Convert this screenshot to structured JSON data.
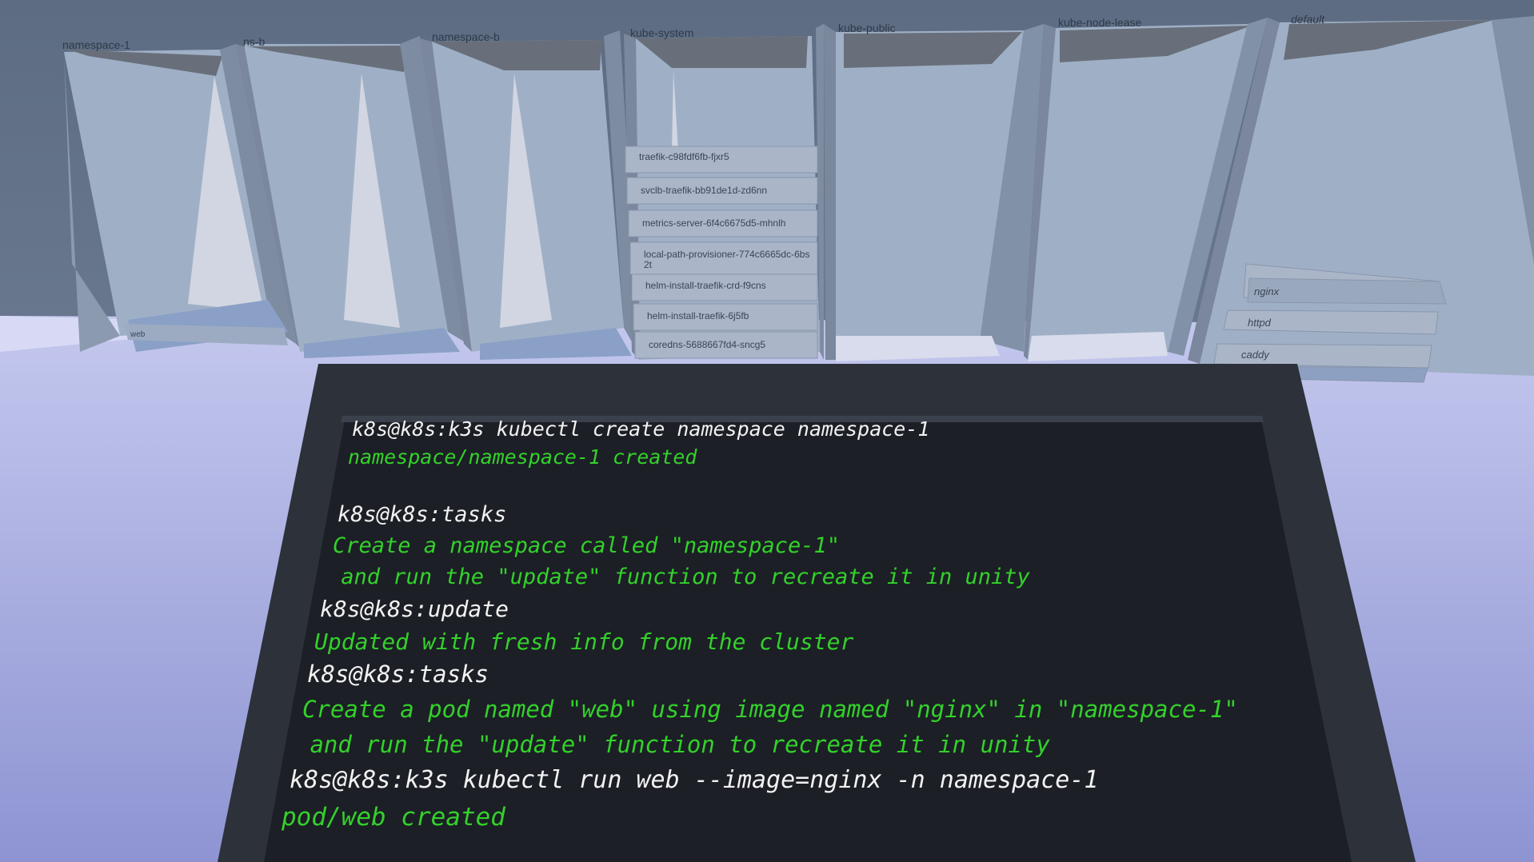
{
  "scene": {
    "namespaces": [
      {
        "name": "namespace-1",
        "pods": [
          "web"
        ]
      },
      {
        "name": "ns-b",
        "pods": []
      },
      {
        "name": "namespace-b",
        "pods": []
      },
      {
        "name": "kube-system",
        "pods": [
          "traefik-c98fdf6fb-fjxr5",
          "svclb-traefik-bb91de1d-zd6nn",
          "metrics-server-6f4c6675d5-mhnlh",
          "local-path-provisioner-774c6665dc-6bs2t",
          "helm-install-traefik-crd-f9cns",
          "helm-install-traefik-6j5fb",
          "coredns-5688667fd4-sncg5"
        ]
      },
      {
        "name": "kube-public",
        "pods": []
      },
      {
        "name": "kube-node-lease",
        "pods": []
      },
      {
        "name": "default",
        "pods": [
          "nginx",
          "httpd",
          "caddy"
        ]
      }
    ]
  },
  "terminal": {
    "lines": [
      {
        "type": "command",
        "text": "k8s@k8s:k3s kubectl create namespace namespace-1"
      },
      {
        "type": "output",
        "text": "namespace/namespace-1 created"
      },
      {
        "type": "command",
        "text": "k8s@k8s:tasks"
      },
      {
        "type": "output",
        "text": "Create a namespace called \"namespace-1\""
      },
      {
        "type": "output",
        "text": " and run the \"update\" function to recreate it in unity"
      },
      {
        "type": "command",
        "text": "k8s@k8s:update"
      },
      {
        "type": "output",
        "text": "Updated with fresh info from the cluster"
      },
      {
        "type": "command",
        "text": "k8s@k8s:tasks"
      },
      {
        "type": "output",
        "text": "Create a pod named \"web\" using image named \"nginx\" in \"namespace-1\""
      },
      {
        "type": "output",
        "text": " and run the \"update\" function to recreate it in unity"
      },
      {
        "type": "command",
        "text": "k8s@k8s:k3s kubectl run web --image=nginx -n namespace-1"
      },
      {
        "type": "output",
        "text": "pod/web created"
      }
    ]
  },
  "colors": {
    "command_text": "#f2f2f2",
    "output_text": "#33d12a",
    "terminal_bg": "#1c1f26",
    "floor": "#a2a8dc",
    "sky": "#6f7f95"
  }
}
